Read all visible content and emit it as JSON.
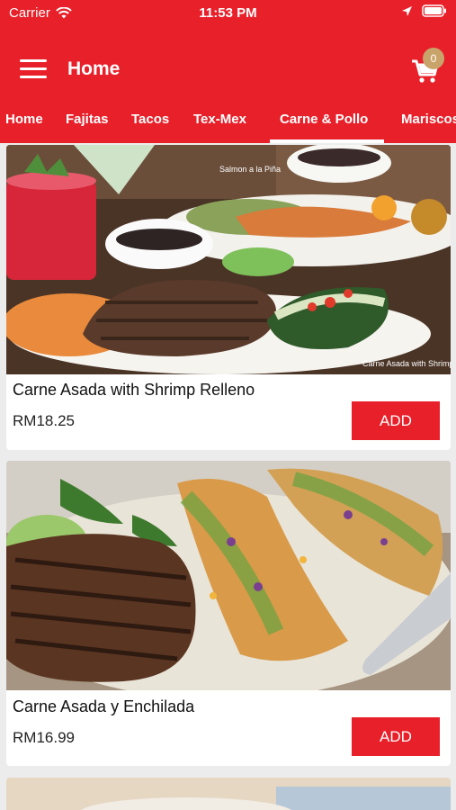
{
  "status_bar": {
    "carrier": "Carrier",
    "time": "11:53 PM"
  },
  "header": {
    "title": "Home",
    "cart_count": "0"
  },
  "tabs": [
    {
      "label": "Home"
    },
    {
      "label": "Fajitas"
    },
    {
      "label": "Tacos"
    },
    {
      "label": "Tex-Mex"
    },
    {
      "label": "Carne & Pollo"
    },
    {
      "label": "Mariscos"
    }
  ],
  "selected_tab": "Carne & Pollo",
  "items": [
    {
      "name": "Carne Asada with Shrimp Relleno",
      "price": "RM18.25",
      "add_label": "ADD",
      "photo_captions": [
        "Salmon a la Piña",
        "Carne Asada with Shrimp"
      ]
    },
    {
      "name": "Carne Asada y Enchilada",
      "price": "RM16.99",
      "add_label": "ADD"
    }
  ],
  "colors": {
    "brand_red": "#e8202a",
    "badge": "#c9a46a",
    "background": "#ececec"
  }
}
